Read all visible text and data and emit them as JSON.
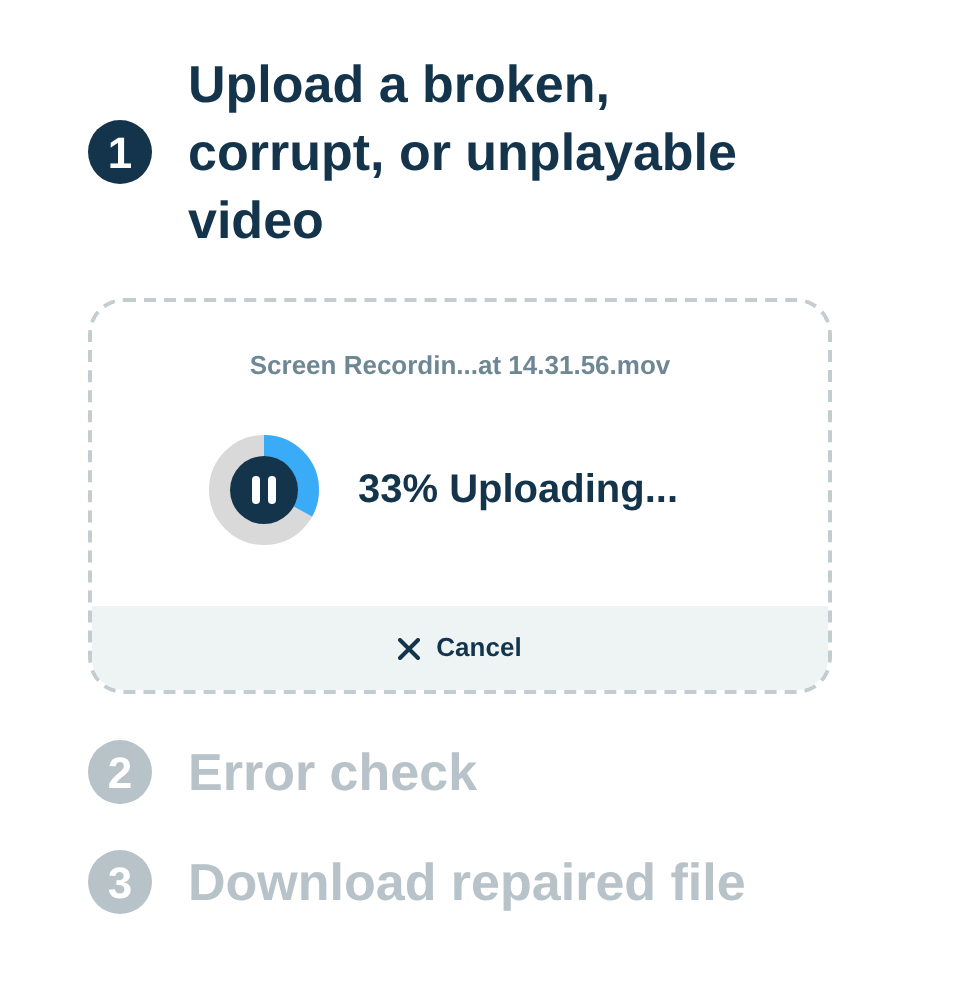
{
  "steps": [
    {
      "number": "1",
      "label": "Upload a broken, corrupt, or unplayable video",
      "active": true
    },
    {
      "number": "2",
      "label": "Error check",
      "active": false
    },
    {
      "number": "3",
      "label": "Download repaired file",
      "active": false
    }
  ],
  "upload": {
    "filename": "Screen Recordin...at 14.31.56.mov",
    "status": "33% Uploading...",
    "paused": false,
    "cancel": "Cancel"
  }
}
